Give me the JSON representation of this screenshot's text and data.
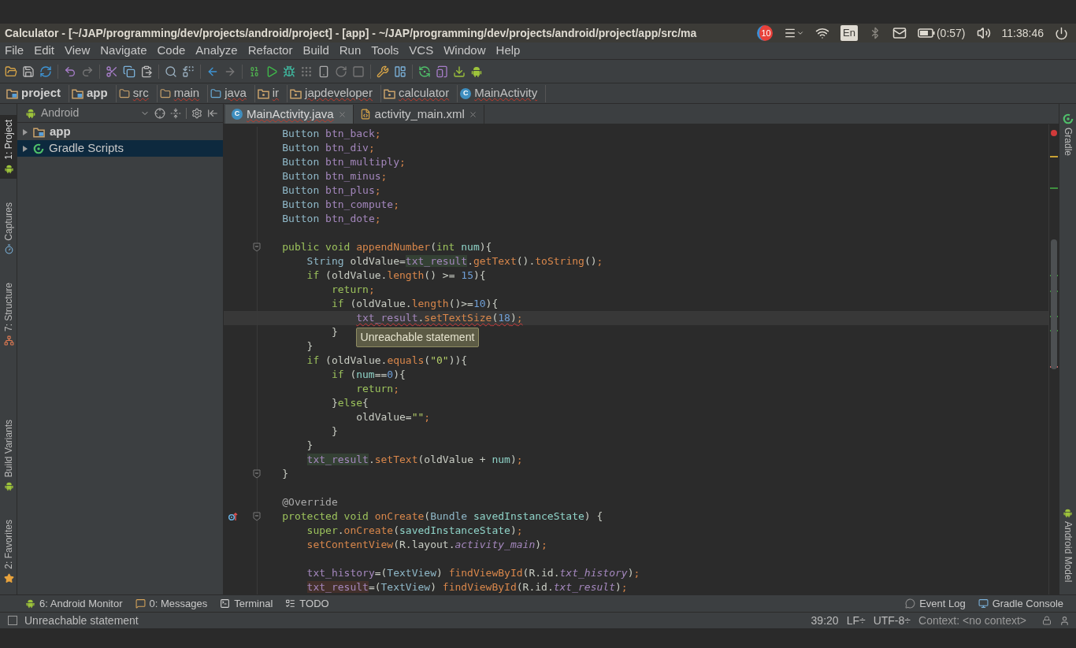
{
  "title_bar": {
    "title": "Calculator - [~/JAP/programming/dev/projects/android/project] - [app] - ~/JAP/programming/dev/projects/android/project/app/src/ma",
    "notification_count": "10",
    "keyboard_layout": "En",
    "battery_time": "(0:57)",
    "clock": "11:38:46"
  },
  "menu": [
    "File",
    "Edit",
    "View",
    "Navigate",
    "Code",
    "Analyze",
    "Refactor",
    "Build",
    "Run",
    "Tools",
    "VCS",
    "Window",
    "Help"
  ],
  "breadcrumbs": [
    {
      "label": "project",
      "kind": "module",
      "misspelled": false
    },
    {
      "label": "app",
      "kind": "module",
      "misspelled": false
    },
    {
      "label": "src",
      "kind": "folder",
      "misspelled": true
    },
    {
      "label": "main",
      "kind": "folder",
      "misspelled": true
    },
    {
      "label": "java",
      "kind": "source",
      "misspelled": true
    },
    {
      "label": "ir",
      "kind": "package",
      "misspelled": true
    },
    {
      "label": "japdeveloper",
      "kind": "package",
      "misspelled": true
    },
    {
      "label": "calculator",
      "kind": "package",
      "misspelled": true
    },
    {
      "label": "MainActivity",
      "kind": "class",
      "badge": "C",
      "misspelled": true
    }
  ],
  "left_tabs": [
    {
      "label": "1: Project",
      "kind": "project",
      "selected": true
    },
    {
      "label": "Captures",
      "kind": "captures",
      "selected": false
    },
    {
      "label": "7: Structure",
      "kind": "structure",
      "selected": false
    },
    {
      "label": "Build Variants",
      "kind": "variants",
      "selected": false
    },
    {
      "label": "2: Favorites",
      "kind": "favorites",
      "selected": false
    }
  ],
  "project_panel": {
    "view": "Android",
    "tree": [
      {
        "label": "app",
        "kind": "module",
        "expanded": false,
        "selected": false
      },
      {
        "label": "Gradle Scripts",
        "kind": "gradle",
        "expanded": false,
        "selected": true
      }
    ]
  },
  "editor_tabs": [
    {
      "label": "MainActivity.java",
      "kind": "class",
      "badge": "C",
      "selected": true
    },
    {
      "label": "activity_main.xml",
      "kind": "layout",
      "selected": false
    }
  ],
  "code_lines": [
    {
      "kind": "code",
      "fold": false,
      "current": false,
      "error": false,
      "tokens": [
        {
          "text": "Button ",
          "kind": "type"
        },
        {
          "text": "btn_back",
          "kind": "field"
        },
        {
          "text": ";",
          "kind": "punct"
        }
      ]
    },
    {
      "kind": "code",
      "fold": false,
      "current": false,
      "error": false,
      "tokens": [
        {
          "text": "Button ",
          "kind": "type"
        },
        {
          "text": "btn_div",
          "kind": "field"
        },
        {
          "text": ";",
          "kind": "punct"
        }
      ]
    },
    {
      "kind": "code",
      "fold": false,
      "current": false,
      "error": false,
      "tokens": [
        {
          "text": "Button ",
          "kind": "type"
        },
        {
          "text": "btn_multiply",
          "kind": "field"
        },
        {
          "text": ";",
          "kind": "punct"
        }
      ]
    },
    {
      "kind": "code",
      "fold": false,
      "current": false,
      "error": false,
      "tokens": [
        {
          "text": "Button ",
          "kind": "type"
        },
        {
          "text": "btn_minus",
          "kind": "field"
        },
        {
          "text": ";",
          "kind": "punct"
        }
      ]
    },
    {
      "kind": "code",
      "fold": false,
      "current": false,
      "error": false,
      "tokens": [
        {
          "text": "Button ",
          "kind": "type"
        },
        {
          "text": "btn_plus",
          "kind": "field"
        },
        {
          "text": ";",
          "kind": "punct"
        }
      ]
    },
    {
      "kind": "code",
      "fold": false,
      "current": false,
      "error": false,
      "tokens": [
        {
          "text": "Button ",
          "kind": "type"
        },
        {
          "text": "btn_compute",
          "kind": "field"
        },
        {
          "text": ";",
          "kind": "punct"
        }
      ]
    },
    {
      "kind": "code",
      "fold": false,
      "current": false,
      "error": false,
      "tokens": [
        {
          "text": "Button ",
          "kind": "type"
        },
        {
          "text": "btn_dote",
          "kind": "field"
        },
        {
          "text": ";",
          "kind": "punct"
        }
      ]
    },
    {
      "kind": "blank"
    },
    {
      "kind": "code",
      "fold": true,
      "current": false,
      "error": false,
      "tokens": [
        {
          "text": "public void ",
          "kind": "kw"
        },
        {
          "text": "appendNumber",
          "kind": "method"
        },
        {
          "text": "(",
          "kind": "plain"
        },
        {
          "text": "int ",
          "kind": "kw"
        },
        {
          "text": "num",
          "kind": "param"
        },
        {
          "text": "){",
          "kind": "plain"
        }
      ],
      "children": [
        {
          "kind": "code",
          "fold": false,
          "current": false,
          "error": false,
          "tokens": [
            {
              "text": "String ",
              "kind": "type"
            },
            {
              "text": "oldValue=",
              "kind": "plain"
            },
            {
              "text": "txt_result",
              "kind": "field-usage"
            },
            {
              "text": ".",
              "kind": "plain"
            },
            {
              "text": "getText",
              "kind": "method"
            },
            {
              "text": "().",
              "kind": "plain"
            },
            {
              "text": "toString",
              "kind": "method"
            },
            {
              "text": "()",
              "kind": "plain"
            },
            {
              "text": ";",
              "kind": "punct"
            }
          ]
        },
        {
          "kind": "code",
          "fold": false,
          "current": false,
          "error": false,
          "tokens": [
            {
              "text": "if ",
              "kind": "kw"
            },
            {
              "text": "(oldValue.",
              "kind": "plain"
            },
            {
              "text": "length",
              "kind": "method"
            },
            {
              "text": "() >= ",
              "kind": "plain"
            },
            {
              "text": "15",
              "kind": "num"
            },
            {
              "text": "){",
              "kind": "plain"
            }
          ],
          "children": [
            {
              "kind": "code",
              "fold": false,
              "current": false,
              "error": false,
              "tokens": [
                {
                  "text": "return",
                  "kind": "kw"
                },
                {
                  "text": ";",
                  "kind": "punct"
                }
              ]
            },
            {
              "kind": "code",
              "fold": false,
              "current": false,
              "error": false,
              "tokens": [
                {
                  "text": "if ",
                  "kind": "kw"
                },
                {
                  "text": "(oldValue.",
                  "kind": "plain"
                },
                {
                  "text": "length",
                  "kind": "method"
                },
                {
                  "text": "()>=",
                  "kind": "plain"
                },
                {
                  "text": "10",
                  "kind": "num"
                },
                {
                  "text": "){",
                  "kind": "plain"
                }
              ],
              "children": [
                {
                  "kind": "code",
                  "fold": false,
                  "current": true,
                  "error": true,
                  "tooltip": "Unreachable statement",
                  "tokens": [
                    {
                      "text": "txt_result",
                      "kind": "field"
                    },
                    {
                      "text": ".",
                      "kind": "plain"
                    },
                    {
                      "text": "setTextSize",
                      "kind": "method"
                    },
                    {
                      "text": "(",
                      "kind": "plain"
                    },
                    {
                      "text": "18",
                      "kind": "num"
                    },
                    {
                      "text": ")",
                      "kind": "plain"
                    },
                    {
                      "text": ";",
                      "kind": "punct"
                    }
                  ]
                }
              ]
            },
            {
              "kind": "code",
              "fold": false,
              "current": false,
              "error": false,
              "tokens": [
                {
                  "text": "}",
                  "kind": "plain"
                }
              ]
            }
          ]
        },
        {
          "kind": "code",
          "fold": false,
          "current": false,
          "error": false,
          "tokens": [
            {
              "text": "}",
              "kind": "plain"
            }
          ]
        },
        {
          "kind": "code",
          "fold": false,
          "current": false,
          "error": false,
          "tokens": [
            {
              "text": "if ",
              "kind": "kw"
            },
            {
              "text": "(oldValue.",
              "kind": "plain"
            },
            {
              "text": "equals",
              "kind": "method"
            },
            {
              "text": "(",
              "kind": "plain"
            },
            {
              "text": "\"0\"",
              "kind": "str"
            },
            {
              "text": ")){",
              "kind": "plain"
            }
          ],
          "children": [
            {
              "kind": "code",
              "fold": false,
              "current": false,
              "error": false,
              "tokens": [
                {
                  "text": "if ",
                  "kind": "kw"
                },
                {
                  "text": "(",
                  "kind": "plain"
                },
                {
                  "text": "num",
                  "kind": "param"
                },
                {
                  "text": "==",
                  "kind": "plain"
                },
                {
                  "text": "0",
                  "kind": "num"
                },
                {
                  "text": "){",
                  "kind": "plain"
                }
              ],
              "children": [
                {
                  "kind": "code",
                  "fold": false,
                  "current": false,
                  "error": false,
                  "tokens": [
                    {
                      "text": "return",
                      "kind": "kw"
                    },
                    {
                      "text": ";",
                      "kind": "punct"
                    }
                  ]
                }
              ]
            },
            {
              "kind": "code",
              "fold": false,
              "current": false,
              "error": false,
              "tokens": [
                {
                  "text": "}",
                  "kind": "plain"
                },
                {
                  "text": "else",
                  "kind": "kw"
                },
                {
                  "text": "{",
                  "kind": "plain"
                }
              ],
              "children": [
                {
                  "kind": "code",
                  "fold": false,
                  "current": false,
                  "error": false,
                  "tokens": [
                    {
                      "text": "oldValue=",
                      "kind": "plain"
                    },
                    {
                      "text": "\"\"",
                      "kind": "str"
                    },
                    {
                      "text": ";",
                      "kind": "punct"
                    }
                  ]
                }
              ]
            },
            {
              "kind": "code",
              "fold": false,
              "current": false,
              "error": false,
              "tokens": [
                {
                  "text": "}",
                  "kind": "plain"
                }
              ]
            }
          ]
        },
        {
          "kind": "code",
          "fold": false,
          "current": false,
          "error": false,
          "tokens": [
            {
              "text": "}",
              "kind": "plain"
            }
          ]
        },
        {
          "kind": "code",
          "fold": false,
          "current": false,
          "error": false,
          "tokens": [
            {
              "text": "txt_result",
              "kind": "field-usage"
            },
            {
              "text": ".",
              "kind": "plain"
            },
            {
              "text": "setText",
              "kind": "method"
            },
            {
              "text": "(oldValue + ",
              "kind": "plain"
            },
            {
              "text": "num",
              "kind": "param"
            },
            {
              "text": ")",
              "kind": "plain"
            },
            {
              "text": ";",
              "kind": "punct"
            }
          ]
        }
      ]
    },
    {
      "kind": "code",
      "fold": true,
      "current": false,
      "error": false,
      "tokens": [
        {
          "text": "}",
          "kind": "plain"
        }
      ]
    },
    {
      "kind": "blank"
    },
    {
      "kind": "code",
      "fold": false,
      "current": false,
      "error": false,
      "tokens": [
        {
          "text": "@Override",
          "kind": "annot"
        }
      ]
    },
    {
      "kind": "override",
      "fold": true,
      "current": false,
      "error": false,
      "tokens": [
        {
          "text": "protected void ",
          "kind": "kw"
        },
        {
          "text": "onCreate",
          "kind": "method"
        },
        {
          "text": "(",
          "kind": "plain"
        },
        {
          "text": "Bundle ",
          "kind": "type"
        },
        {
          "text": "savedInstanceState",
          "kind": "param"
        },
        {
          "text": ") {",
          "kind": "plain"
        }
      ],
      "children": [
        {
          "kind": "code",
          "fold": false,
          "current": false,
          "error": false,
          "tokens": [
            {
              "text": "super",
              "kind": "kw"
            },
            {
              "text": ".",
              "kind": "plain"
            },
            {
              "text": "onCreate",
              "kind": "method"
            },
            {
              "text": "(",
              "kind": "plain"
            },
            {
              "text": "savedInstanceState",
              "kind": "param"
            },
            {
              "text": ")",
              "kind": "plain"
            },
            {
              "text": ";",
              "kind": "punct"
            }
          ]
        },
        {
          "kind": "code",
          "fold": false,
          "current": false,
          "error": false,
          "tokens": [
            {
              "text": "setContentView",
              "kind": "method"
            },
            {
              "text": "(R.layout.",
              "kind": "plain"
            },
            {
              "text": "activity_main",
              "kind": "field-italic"
            },
            {
              "text": ")",
              "kind": "plain"
            },
            {
              "text": ";",
              "kind": "punct"
            }
          ]
        },
        {
          "kind": "blank"
        },
        {
          "kind": "code",
          "fold": false,
          "current": false,
          "error": false,
          "tokens": [
            {
              "text": "txt_history",
              "kind": "field"
            },
            {
              "text": "=(",
              "kind": "plain"
            },
            {
              "text": "TextView",
              "kind": "type"
            },
            {
              "text": ") ",
              "kind": "plain"
            },
            {
              "text": "findViewById",
              "kind": "method"
            },
            {
              "text": "(R.id.",
              "kind": "plain"
            },
            {
              "text": "txt_history",
              "kind": "field-italic"
            },
            {
              "text": ")",
              "kind": "plain"
            },
            {
              "text": ";",
              "kind": "punct"
            }
          ]
        },
        {
          "kind": "code",
          "fold": false,
          "current": false,
          "error": false,
          "tokens": [
            {
              "text": "txt_result",
              "kind": "field-assign"
            },
            {
              "text": "=(",
              "kind": "plain"
            },
            {
              "text": "TextView",
              "kind": "type"
            },
            {
              "text": ") ",
              "kind": "plain"
            },
            {
              "text": "findViewById",
              "kind": "method"
            },
            {
              "text": "(R.id.",
              "kind": "plain"
            },
            {
              "text": "txt_result",
              "kind": "field-italic"
            },
            {
              "text": ")",
              "kind": "plain"
            },
            {
              "text": ";",
              "kind": "punct"
            }
          ]
        }
      ]
    }
  ],
  "right_tabs": [
    {
      "label": "Gradle",
      "kind": "gradle"
    },
    {
      "label": "Android Model",
      "kind": "android"
    }
  ],
  "tool_windows": {
    "left": [
      {
        "label": "6: Android Monitor",
        "kind": "android"
      },
      {
        "label": "0: Messages",
        "kind": "messages"
      },
      {
        "label": "Terminal",
        "kind": "terminal"
      },
      {
        "label": "TODO",
        "kind": "todo"
      }
    ],
    "right": [
      {
        "label": "Event Log",
        "kind": "event"
      },
      {
        "label": "Gradle Console",
        "kind": "console"
      }
    ]
  },
  "status_bar": {
    "message": "Unreachable statement",
    "position": "39:20",
    "line_separator": "LF÷",
    "encoding": "UTF-8÷",
    "context": "Context: <no context>"
  }
}
